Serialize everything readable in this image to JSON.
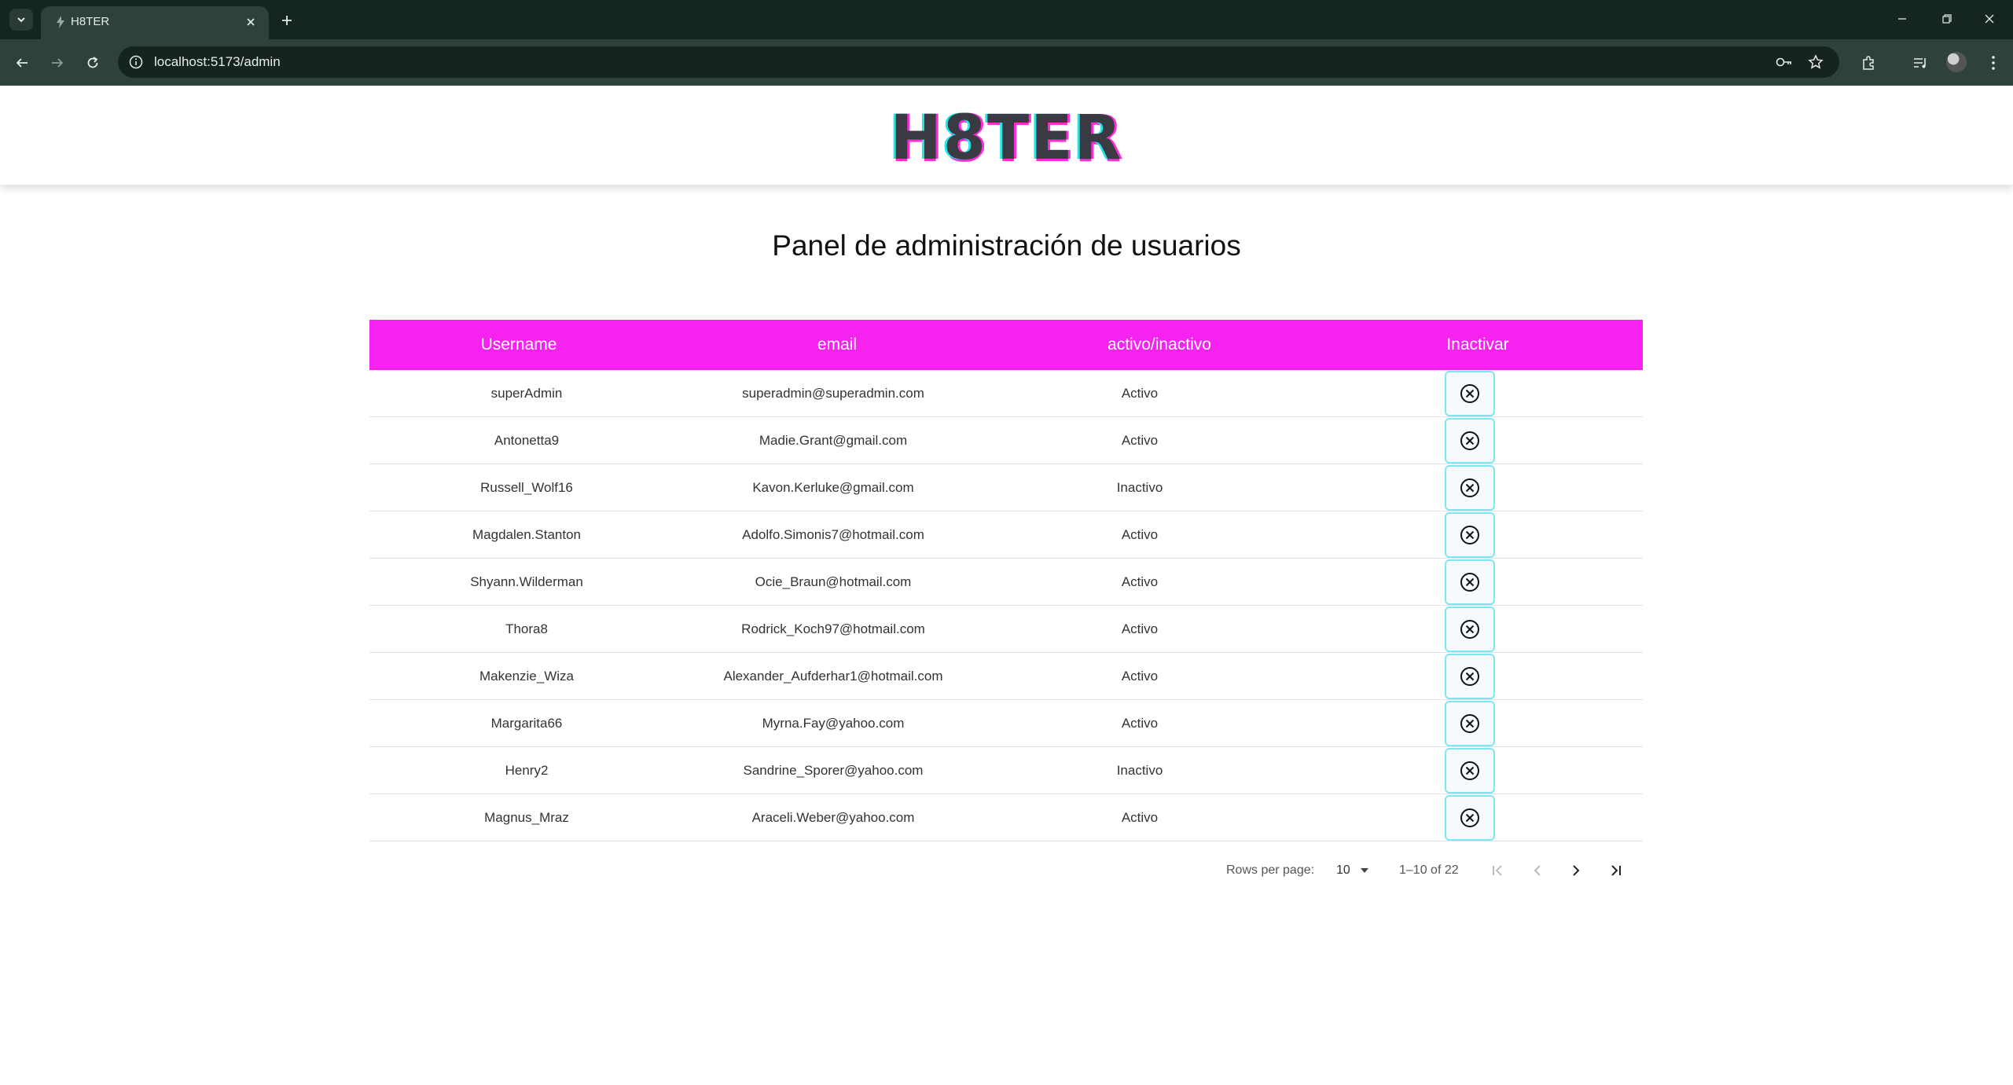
{
  "browser": {
    "tab_title": "H8TER",
    "url": "localhost:5173/admin"
  },
  "app": {
    "logo_text": "H8TER",
    "page_title": "Panel de administración de usuarios"
  },
  "colors": {
    "header_magenta": "#f522f0",
    "button_border_cyan": "#7ee6ee",
    "logo_cyan": "#1ee8e8",
    "logo_pink": "#ff2bd6"
  },
  "table": {
    "headers": [
      "Username",
      "email",
      "activo/inactivo",
      "Inactivar"
    ],
    "action_icon": "circle-x-icon",
    "rows": [
      {
        "username": "superAdmin",
        "email": "superadmin@superadmin.com",
        "status": "Activo"
      },
      {
        "username": "Antonetta9",
        "email": "Madie.Grant@gmail.com",
        "status": "Activo"
      },
      {
        "username": "Russell_Wolf16",
        "email": "Kavon.Kerluke@gmail.com",
        "status": "Inactivo"
      },
      {
        "username": "Magdalen.Stanton",
        "email": "Adolfo.Simonis7@hotmail.com",
        "status": "Activo"
      },
      {
        "username": "Shyann.Wilderman",
        "email": "Ocie_Braun@hotmail.com",
        "status": "Activo"
      },
      {
        "username": "Thora8",
        "email": "Rodrick_Koch97@hotmail.com",
        "status": "Activo"
      },
      {
        "username": "Makenzie_Wiza",
        "email": "Alexander_Aufderhar1@hotmail.com",
        "status": "Activo"
      },
      {
        "username": "Margarita66",
        "email": "Myrna.Fay@yahoo.com",
        "status": "Activo"
      },
      {
        "username": "Henry2",
        "email": "Sandrine_Sporer@yahoo.com",
        "status": "Inactivo"
      },
      {
        "username": "Magnus_Mraz",
        "email": "Araceli.Weber@yahoo.com",
        "status": "Activo"
      }
    ]
  },
  "pagination": {
    "rows_per_page_label": "Rows per page:",
    "rows_per_page_value": "10",
    "range_text": "1–10 of 22"
  }
}
